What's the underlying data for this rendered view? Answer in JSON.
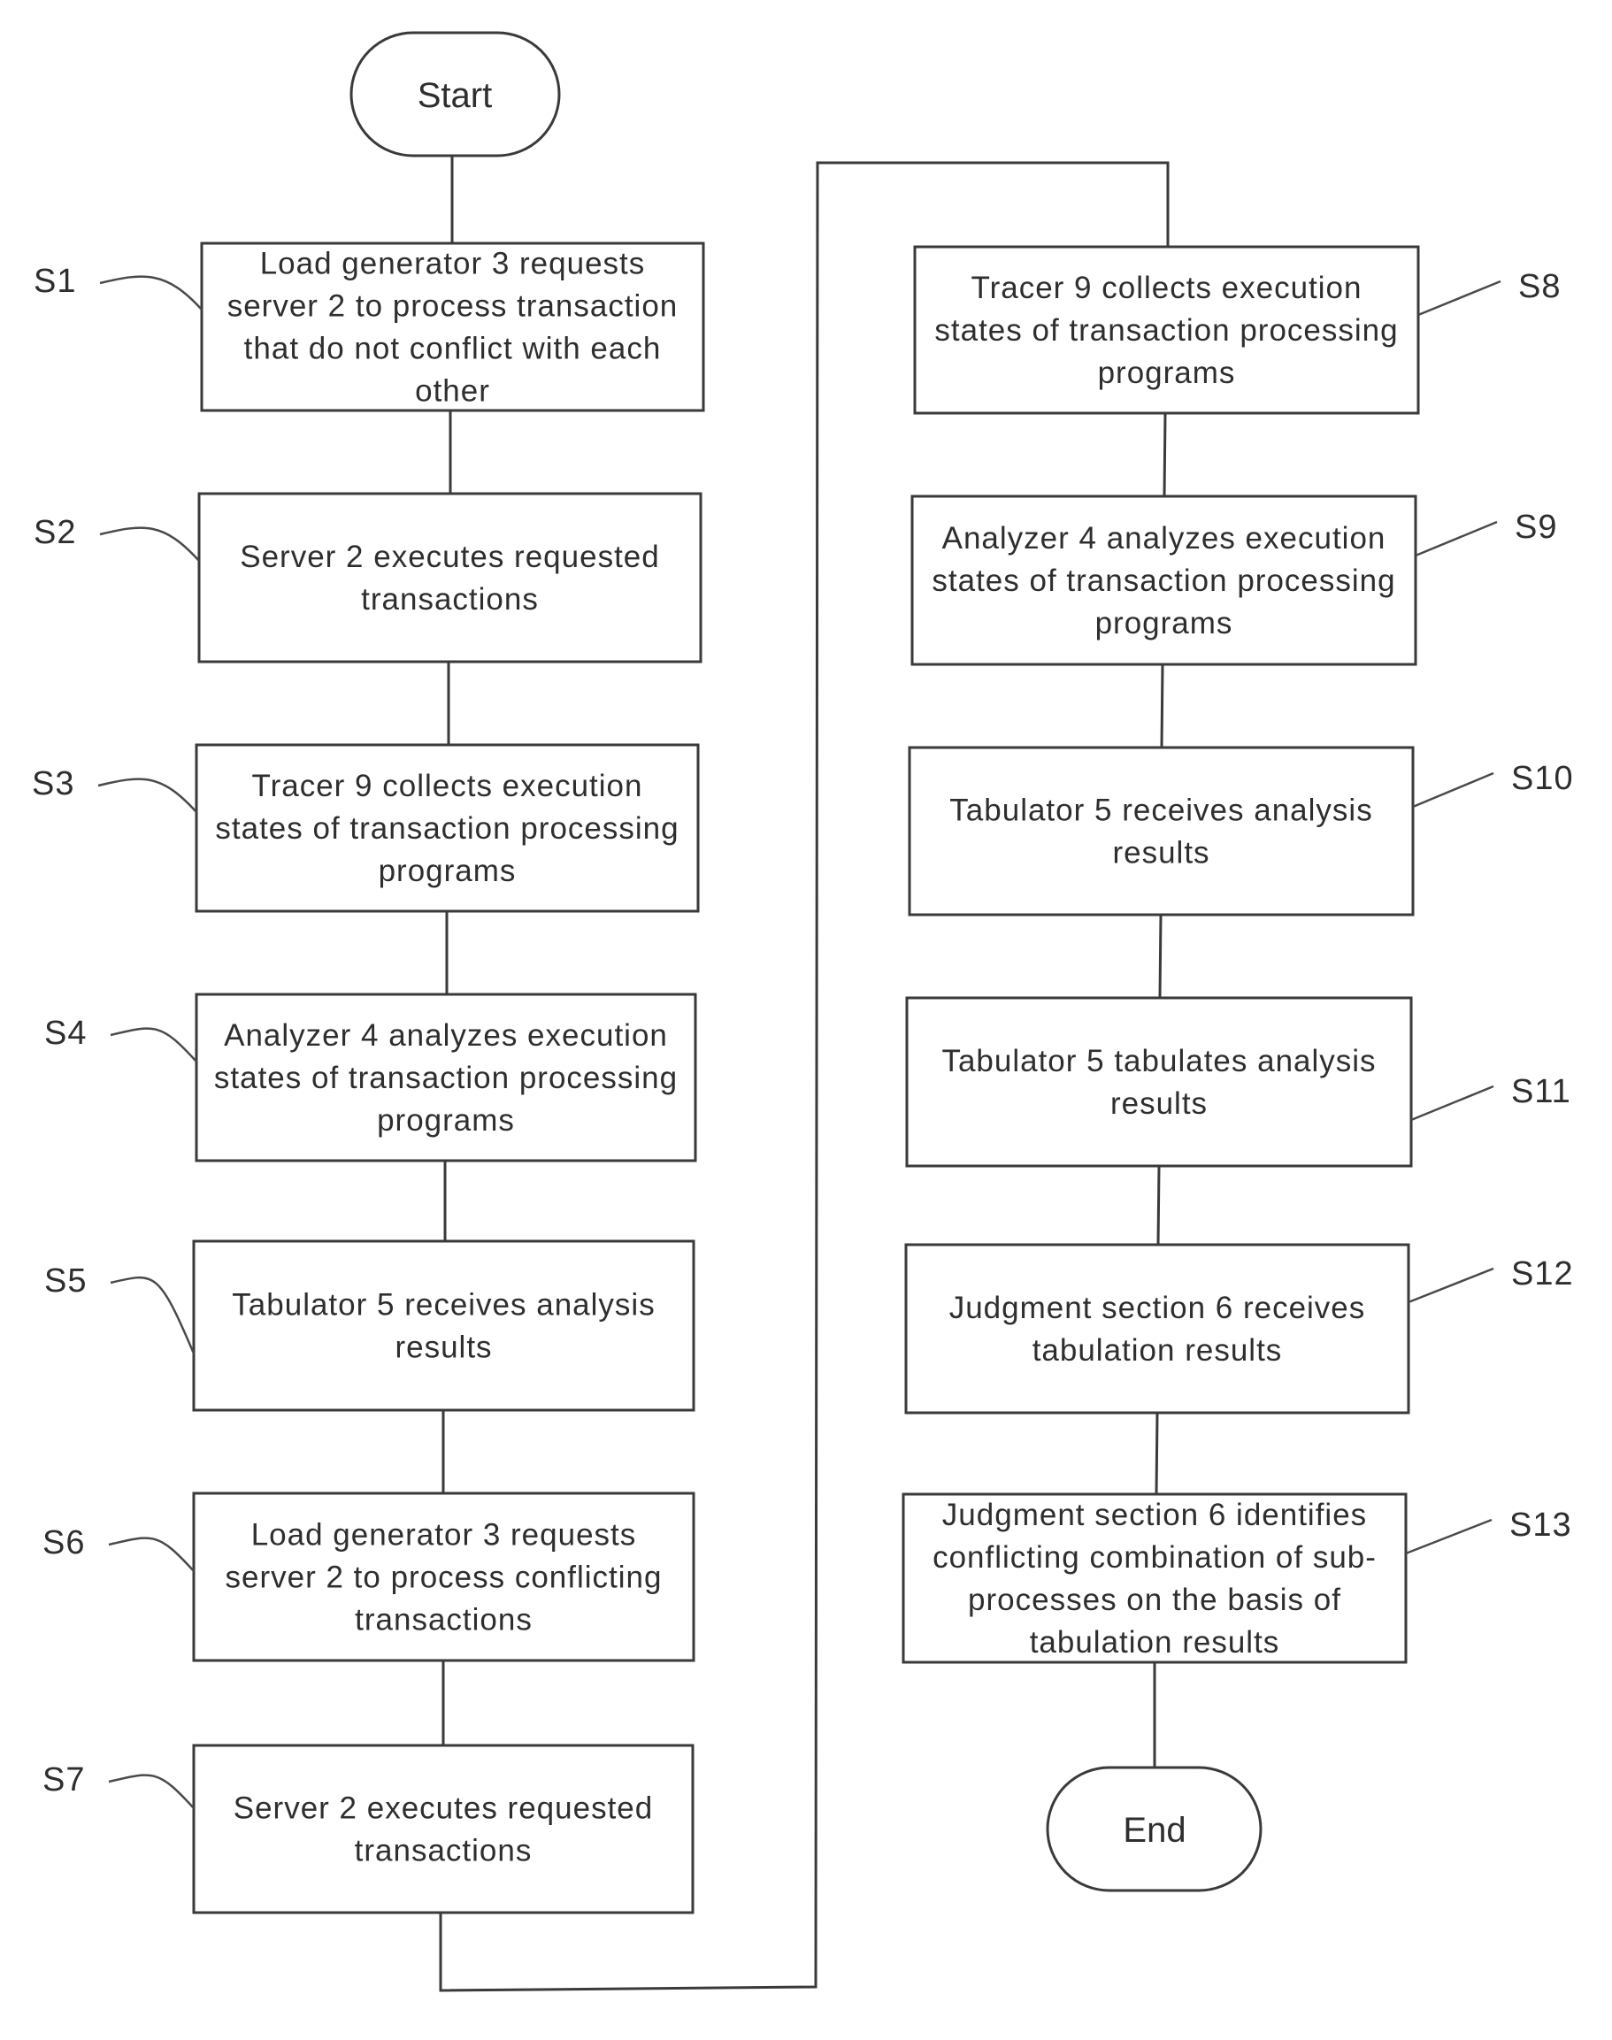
{
  "terminals": {
    "start": "Start",
    "end": "End"
  },
  "steps": [
    {
      "id": "S1",
      "lines": [
        "Load generator 3 requests",
        "server 2 to process transaction",
        "that do not conflict with each",
        "other"
      ]
    },
    {
      "id": "S2",
      "lines": [
        "Server 2 executes requested",
        "transactions"
      ]
    },
    {
      "id": "S3",
      "lines": [
        "Tracer 9 collects execution",
        "states of transaction processing",
        "programs"
      ]
    },
    {
      "id": "S4",
      "lines": [
        "Analyzer 4 analyzes execution",
        "states of transaction processing",
        "programs"
      ]
    },
    {
      "id": "S5",
      "lines": [
        "Tabulator 5 receives analysis",
        "results"
      ]
    },
    {
      "id": "S6",
      "lines": [
        "Load generator 3 requests",
        "server 2 to process conflicting",
        "transactions"
      ]
    },
    {
      "id": "S7",
      "lines": [
        "Server 2 executes requested",
        "transactions"
      ]
    },
    {
      "id": "S8",
      "lines": [
        "Tracer 9 collects execution",
        "states of transaction processing",
        "programs"
      ]
    },
    {
      "id": "S9",
      "lines": [
        "Analyzer 4 analyzes execution",
        "states of transaction processing",
        "programs"
      ]
    },
    {
      "id": "S10",
      "lines": [
        "Tabulator 5 receives analysis",
        "results"
      ]
    },
    {
      "id": "S11",
      "lines": [
        "Tabulator 5 tabulates analysis",
        "results"
      ]
    },
    {
      "id": "S12",
      "lines": [
        "Judgment section 6 receives",
        "tabulation results"
      ]
    },
    {
      "id": "S13",
      "lines": [
        "Judgment section 6 identifies",
        "conflicting combination of sub-",
        "processes on the basis of",
        "tabulation results"
      ]
    }
  ]
}
